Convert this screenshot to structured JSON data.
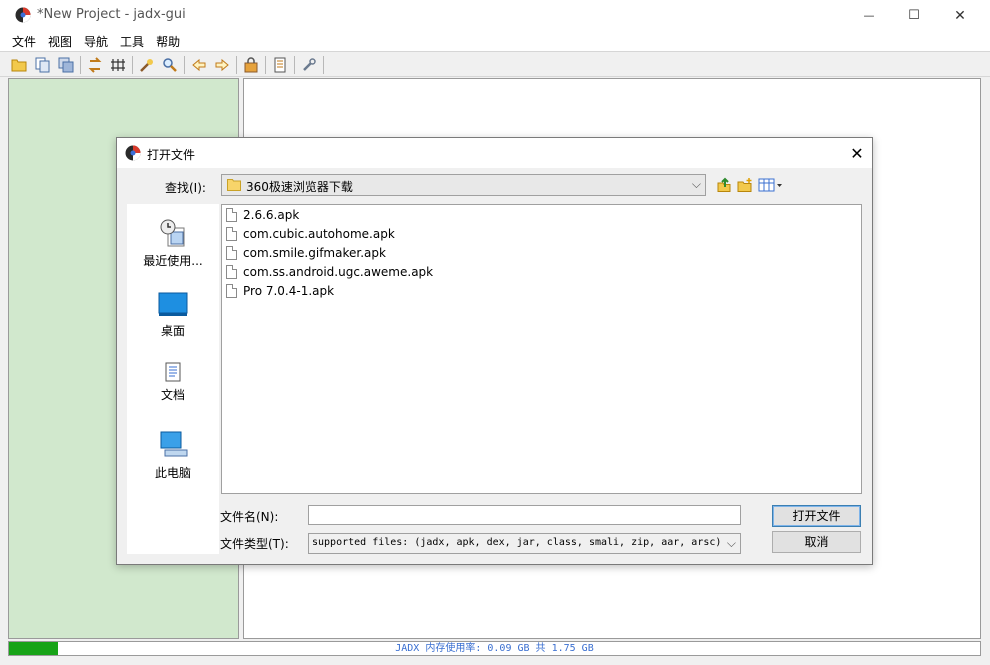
{
  "window": {
    "title": "*New Project - jadx-gui",
    "minimize_glyph": "—",
    "maximize_glyph": "☐",
    "close_glyph": "✕"
  },
  "menu": [
    "文件",
    "视图",
    "导航",
    "工具",
    "帮助"
  ],
  "toolbar": {
    "icons": [
      "open-file-icon",
      "add-files-icon",
      "save-all-icon",
      "sync-tree-icon",
      "flatten-packages-icon",
      "text-search-icon",
      "class-search-icon",
      "back-icon",
      "forward-icon",
      "deobfuscation-icon",
      "log-viewer-icon",
      "preferences-icon"
    ]
  },
  "status": {
    "memory_text": "JADX 内存使用率: 0.09 GB 共 1.75 GB",
    "memory_fraction": 0.05,
    "bar_color": "#17a317"
  },
  "dialog": {
    "title": "打开文件",
    "close_glyph": "✕",
    "look_in_label": "查找(I):",
    "look_in_value": "360极速浏览器下载",
    "places": [
      {
        "label": "最近使用...",
        "icon": "recent-items-icon"
      },
      {
        "label": "桌面",
        "icon": "desktop-icon"
      },
      {
        "label": "文档",
        "icon": "documents-icon"
      },
      {
        "label": "此电脑",
        "icon": "this-pc-icon"
      }
    ],
    "files": [
      "2.6.6.apk",
      "com.cubic.autohome.apk",
      "com.smile.gifmaker.apk",
      "com.ss.android.ugc.aweme.apk",
      "Pro 7.0.4-1.apk"
    ],
    "filename_label": "文件名(N):",
    "filename_value": "",
    "filetype_label": "文件类型(T):",
    "filetype_value": "supported files: (jadx, apk, dex, jar, class, smali, zip, aar, arsc)",
    "open_button": "打开文件",
    "cancel_button": "取消"
  }
}
